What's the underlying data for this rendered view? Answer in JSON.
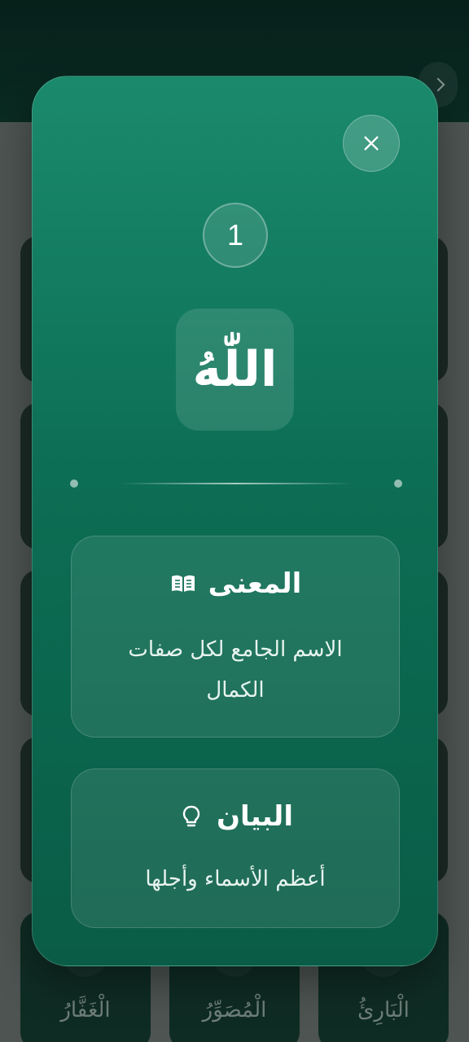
{
  "background": {
    "bottom_cards": [
      {
        "label": "الْغَفَّارُ"
      },
      {
        "label": "الْمُصَوِّرُ"
      },
      {
        "label": "الْبَارِئُ"
      }
    ]
  },
  "modal": {
    "close_icon": "close-icon",
    "number": "1",
    "name": "اللّٰهُ",
    "meaning": {
      "title": "المعنى",
      "icon": "open-book-icon",
      "text": "الاسم الجامع لكل صفات الكمال"
    },
    "explanation": {
      "title": "البيان",
      "icon": "lightbulb-icon",
      "text": "أعظم الأسماء وأجلها"
    }
  },
  "colors": {
    "modal_top": "#1b8a6c",
    "modal_bottom": "#0a5c46",
    "overlay": "#4d5451"
  }
}
